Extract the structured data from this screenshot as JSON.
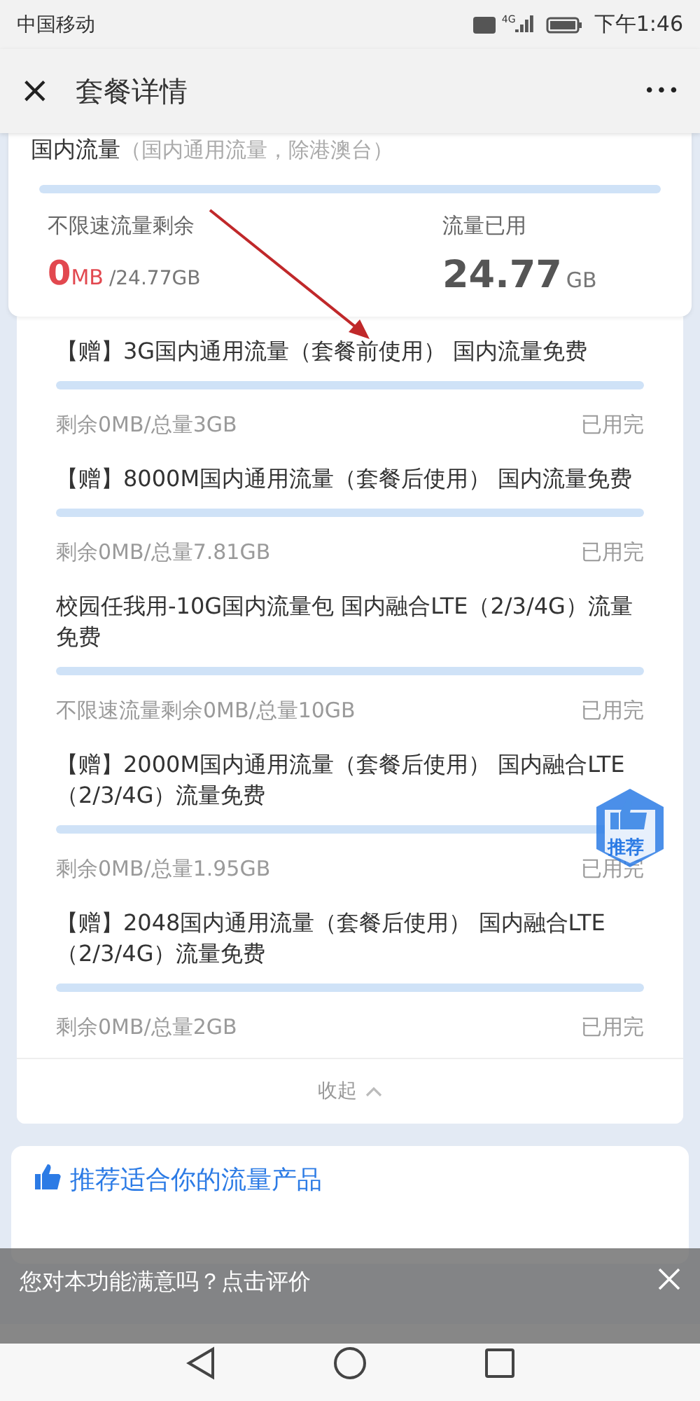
{
  "status_bar": {
    "carrier": "中国移动",
    "network": "4G",
    "time": "下午1:46"
  },
  "header": {
    "close": "×",
    "title": "套餐详情",
    "more": "•••"
  },
  "summary": {
    "title": "国内流量",
    "subtitle": "（国内通用流量，除港澳台）",
    "level": 1,
    "remaining_label": "不限速流量剩余",
    "remaining_value": "0",
    "remaining_unit": "MB",
    "remaining_total": "/24.77GB",
    "used_label": "流量已用",
    "used_value": "24.77",
    "used_unit": "GB"
  },
  "packages": [
    {
      "name": "【赠】3G国内通用流量（套餐前使用） 国内流量免费",
      "level": 1,
      "detail": "剩余0MB/总量3GB",
      "status": "已用完"
    },
    {
      "name": "【赠】8000M国内通用流量（套餐后使用） 国内流量免费",
      "level": 1,
      "detail": "剩余0MB/总量7.81GB",
      "status": "已用完"
    },
    {
      "name": "校园任我用-10G国内流量包 国内融合LTE（2/3/4G）流量免费",
      "level": 1,
      "detail": "不限速流量剩余0MB/总量10GB",
      "status": "已用完"
    },
    {
      "name": "【赠】2000M国内通用流量（套餐后使用） 国内融合LTE（2/3/4G）流量免费",
      "level": 1,
      "detail": "剩余0MB/总量1.95GB",
      "status": "已用完"
    },
    {
      "name": "【赠】2048国内通用流量（套餐后使用） 国内融合LTE（2/3/4G）流量免费",
      "level": 1,
      "detail": "剩余0MB/总量2GB",
      "status": "已用完"
    }
  ],
  "collapse": "收起",
  "float_badge": "推荐",
  "recommend": {
    "title": "推荐适合你的流量产品"
  },
  "feedback": {
    "text": "您对本功能满意吗？点击评价"
  }
}
